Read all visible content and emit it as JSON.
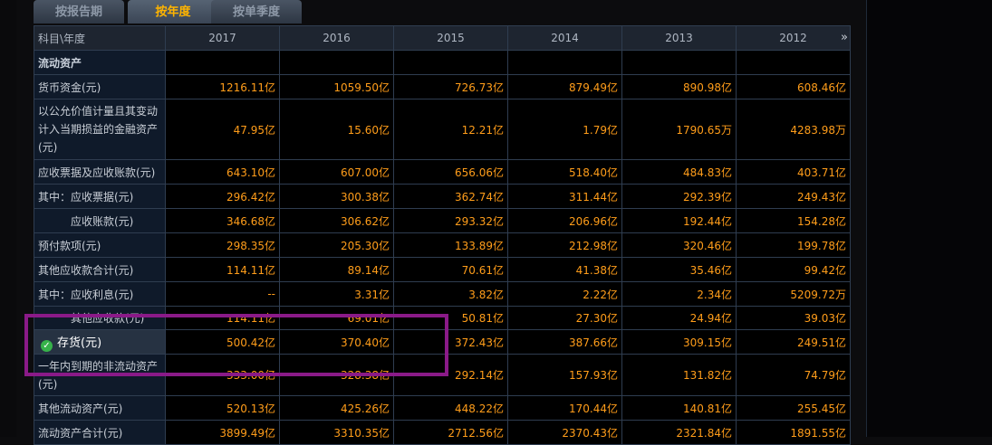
{
  "tabs": [
    {
      "label": "按报告期"
    },
    {
      "label": "按年度"
    },
    {
      "label": "按单季度"
    }
  ],
  "table": {
    "header": {
      "label": "科目\\年度",
      "years": [
        "2017",
        "2016",
        "2015",
        "2014",
        "2013",
        "2012"
      ],
      "more_icon": "»"
    },
    "rows": [
      {
        "label": "流动资产",
        "values": [
          "",
          "",
          "",
          "",
          "",
          ""
        ]
      },
      {
        "label": "货币资金(元)",
        "values": [
          "1216.11亿",
          "1059.50亿",
          "726.73亿",
          "879.49亿",
          "890.98亿",
          "608.46亿"
        ]
      },
      {
        "label": "以公允价值计量且其变动计入当期损益的金融资产(元)",
        "values": [
          "47.95亿",
          "15.60亿",
          "12.21亿",
          "1.79亿",
          "1790.65万",
          "4283.98万"
        ]
      },
      {
        "label": "应收票据及应收账款(元)",
        "values": [
          "643.10亿",
          "607.00亿",
          "656.06亿",
          "518.40亿",
          "484.83亿",
          "403.71亿"
        ]
      },
      {
        "label": "其中：应收票据(元)",
        "values": [
          "296.42亿",
          "300.38亿",
          "362.74亿",
          "311.44亿",
          "292.39亿",
          "249.43亿"
        ]
      },
      {
        "label": "应收账款(元)",
        "values": [
          "346.68亿",
          "306.62亿",
          "293.32亿",
          "206.96亿",
          "192.44亿",
          "154.28亿"
        ]
      },
      {
        "label": "预付款项(元)",
        "values": [
          "298.35亿",
          "205.30亿",
          "133.89亿",
          "212.98亿",
          "320.46亿",
          "199.78亿"
        ]
      },
      {
        "label": "其他应收款合计(元)",
        "values": [
          "114.11亿",
          "89.14亿",
          "70.61亿",
          "41.38亿",
          "35.46亿",
          "99.42亿"
        ]
      },
      {
        "label": "其中：应收利息(元)",
        "values": [
          "--",
          "3.31亿",
          "3.82亿",
          "2.22亿",
          "2.34亿",
          "5209.72万"
        ]
      },
      {
        "label": "其他应收款(元)",
        "values": [
          "114.11亿",
          "69.01亿",
          "50.81亿",
          "27.30亿",
          "24.94亿",
          "39.03亿"
        ]
      },
      {
        "label": "存货(元)",
        "values": [
          "500.42亿",
          "370.40亿",
          "372.43亿",
          "387.66亿",
          "309.15亿",
          "249.51亿"
        ]
      },
      {
        "label": "一年内到期的非流动资产(元)",
        "values": [
          "333.00亿",
          "328.38亿",
          "292.14亿",
          "157.93亿",
          "131.82亿",
          "74.79亿"
        ]
      },
      {
        "label": "其他流动资产(元)",
        "values": [
          "520.13亿",
          "425.26亿",
          "448.22亿",
          "170.44亿",
          "140.81亿",
          "255.45亿"
        ]
      },
      {
        "label": "流动资产合计(元)",
        "values": [
          "3899.49亿",
          "3310.35亿",
          "2712.56亿",
          "2370.43亿",
          "2321.84亿",
          "1891.55亿"
        ]
      }
    ]
  },
  "colors": {
    "value_text": "#ff9d1a",
    "active_tab": "#ffb400",
    "highlight_box": "#8a1a88",
    "check": "#36b24a"
  },
  "icons": {
    "selected_row": "check-circle-icon",
    "more": "double-chevron-right-icon"
  }
}
